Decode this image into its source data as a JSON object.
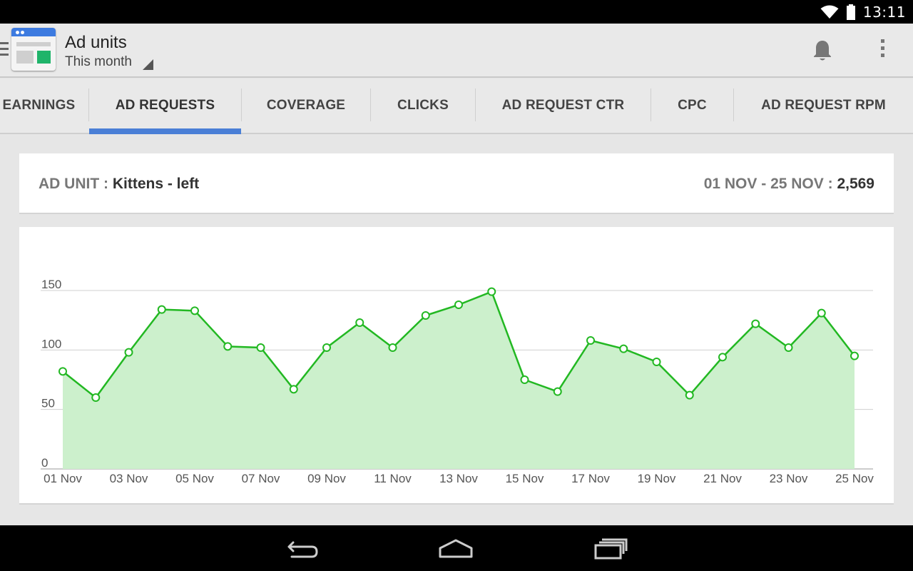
{
  "status_bar": {
    "time": "13:11",
    "icons": [
      "wifi-icon",
      "battery-icon"
    ]
  },
  "action_bar": {
    "title": "Ad units",
    "subtitle": "This month",
    "icons": [
      "menu-icon",
      "app-icon",
      "spinner-caret-icon",
      "notification-bell-icon",
      "overflow-menu-icon"
    ]
  },
  "tabs": [
    {
      "label": "EARNINGS",
      "active": false
    },
    {
      "label": "AD REQUESTS",
      "active": true
    },
    {
      "label": "COVERAGE",
      "active": false
    },
    {
      "label": "CLICKS",
      "active": false
    },
    {
      "label": "AD REQUEST CTR",
      "active": false
    },
    {
      "label": "CPC",
      "active": false
    },
    {
      "label": "AD REQUEST RPM",
      "active": false
    }
  ],
  "summary": {
    "unit_label": "AD UNIT :",
    "unit_name": "Kittens - left",
    "range_label": "01 NOV - 25 NOV :",
    "total": "2,569"
  },
  "colors": {
    "accent": "#4a7fd6",
    "line": "#22b822",
    "fill": "#ccf0cc",
    "status_bar": "#000000"
  },
  "chart_data": {
    "type": "area",
    "x": [
      "01 Nov",
      "02 Nov",
      "03 Nov",
      "04 Nov",
      "05 Nov",
      "06 Nov",
      "07 Nov",
      "08 Nov",
      "09 Nov",
      "10 Nov",
      "11 Nov",
      "12 Nov",
      "13 Nov",
      "14 Nov",
      "15 Nov",
      "16 Nov",
      "17 Nov",
      "18 Nov",
      "19 Nov",
      "20 Nov",
      "21 Nov",
      "22 Nov",
      "23 Nov",
      "24 Nov",
      "25 Nov"
    ],
    "tick_labels": [
      "01 Nov",
      "03 Nov",
      "05 Nov",
      "07 Nov",
      "09 Nov",
      "11 Nov",
      "13 Nov",
      "15 Nov",
      "17 Nov",
      "19 Nov",
      "21 Nov",
      "23 Nov",
      "25 Nov"
    ],
    "values": [
      82,
      60,
      98,
      134,
      133,
      103,
      102,
      67,
      102,
      123,
      102,
      129,
      138,
      149,
      75,
      65,
      108,
      101,
      90,
      62,
      94,
      122,
      102,
      131,
      95
    ],
    "yticks": [
      0,
      50,
      100,
      150
    ],
    "ylim": [
      0,
      150
    ],
    "grid": true,
    "title": "",
    "xlabel": "",
    "ylabel": ""
  },
  "nav_bar": {
    "icons": [
      "back-icon",
      "home-icon",
      "recent-apps-icon"
    ]
  }
}
